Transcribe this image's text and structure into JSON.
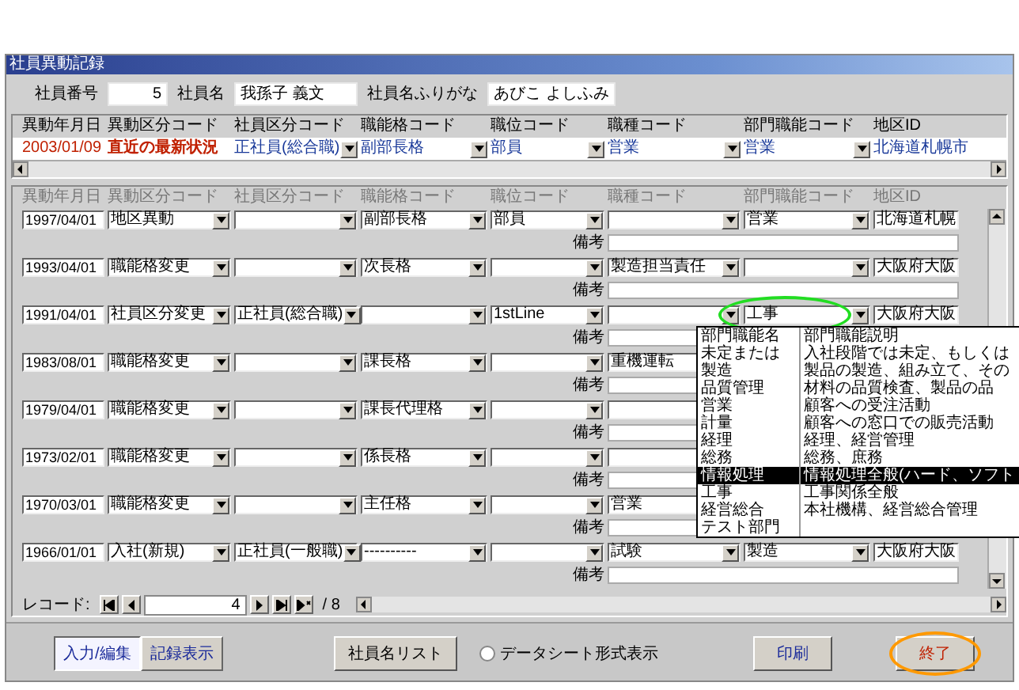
{
  "window": {
    "title": "社員異動記録"
  },
  "employee": [
    {
      "label": "社員番号",
      "value": "5",
      "kind": "number"
    },
    {
      "label": "社員名",
      "value": "我孫子 義文",
      "kind": "text"
    },
    {
      "label": "社員名ふりがな",
      "value": "あびこ よしふみ",
      "kind": "text"
    }
  ],
  "latest": {
    "columns": [
      "異動年月日",
      "異動区分コード",
      "社員区分コード",
      "職能格コード",
      "職位コード",
      "職種コード",
      "部門職能コード",
      "地区ID"
    ],
    "cells": [
      "2003/01/09",
      "直近の最新状況",
      "正社員(総合職)",
      "副部長格",
      "部員",
      "営業",
      "営業",
      "北海道札幌市"
    ]
  },
  "history": {
    "columns": [
      "異動年月日",
      "異動区分コード",
      "社員区分コード",
      "職能格コード",
      "職位コード",
      "職種コード",
      "部門職能コード",
      "地区ID"
    ],
    "records": [
      {
        "date": "1997/04/01",
        "cells": [
          "地区異動",
          "",
          "副部長格",
          "部員",
          "",
          "営業",
          "北海道札幌"
        ],
        "remarks_label": "備考"
      },
      {
        "date": "1993/04/01",
        "cells": [
          "職能格変更",
          "",
          "次長格",
          "",
          "製造担当責任",
          "",
          "大阪府大阪"
        ],
        "remarks_label": "備考"
      },
      {
        "date": "1991/04/01",
        "cells": [
          "社員区分変更",
          "正社員(総合職)",
          "",
          "1stLine",
          "",
          "工事",
          "大阪府大阪"
        ],
        "remarks_label": "備考",
        "highlighted": true
      },
      {
        "date": "1983/08/01",
        "cells": [
          "職能格変更",
          "",
          "課長格",
          "",
          "重機運転",
          "",
          ""
        ],
        "remarks_label": "備考"
      },
      {
        "date": "1979/04/01",
        "cells": [
          "職能格変更",
          "",
          "課長代理格",
          "",
          "",
          "",
          ""
        ],
        "remarks_label": "備考"
      },
      {
        "date": "1973/02/01",
        "cells": [
          "職能格変更",
          "",
          "係長格",
          "",
          "",
          "",
          ""
        ],
        "remarks_label": "備考"
      },
      {
        "date": "1970/03/01",
        "cells": [
          "職能格変更",
          "",
          "主任格",
          "",
          "営業",
          "",
          ""
        ],
        "remarks_label": "備考"
      },
      {
        "date": "1966/01/01",
        "cells": [
          "入社(新規)",
          "正社員(一般職)",
          "----------",
          "",
          "試験",
          "製造",
          "大阪府大阪"
        ],
        "remarks_label": "備考"
      }
    ],
    "dropdown": {
      "columns": [
        "部門職能名",
        "部門職能説明"
      ],
      "items": [
        {
          "name": "未定または",
          "description": "入社段階では未定、もしくは",
          "selected": false
        },
        {
          "name": "製造",
          "description": "製品の製造、組み立て、その",
          "selected": false
        },
        {
          "name": "品質管理",
          "description": "材料の品質検査、製品の品",
          "selected": false
        },
        {
          "name": "営業",
          "description": "顧客への受注活動",
          "selected": false
        },
        {
          "name": "計量",
          "description": "顧客への窓口での販売活動",
          "selected": false
        },
        {
          "name": "経理",
          "description": "経理、経営管理",
          "selected": false
        },
        {
          "name": "総務",
          "description": "総務、庶務",
          "selected": false
        },
        {
          "name": "情報処理",
          "description": "情報処理全般(ハード、ソフト",
          "selected": true
        },
        {
          "name": "工事",
          "description": "工事関係全般",
          "selected": false
        },
        {
          "name": "経営総合",
          "description": "本社機構、経営総合管理",
          "selected": false
        },
        {
          "name": "テスト部門",
          "selected": false
        }
      ]
    },
    "navigator": {
      "label": "レコード:",
      "current": "4",
      "total": "/ 8"
    }
  },
  "bottom": {
    "tabs": [
      {
        "label": "入力/編集",
        "selected": true
      },
      {
        "label": "記録表示",
        "selected": false
      }
    ],
    "list_button": "社員名リスト",
    "datasheet": {
      "label": "データシート形式表示",
      "checked": false
    },
    "print_button": "印刷",
    "close_button": {
      "label": "終了",
      "highlighted": true
    }
  }
}
